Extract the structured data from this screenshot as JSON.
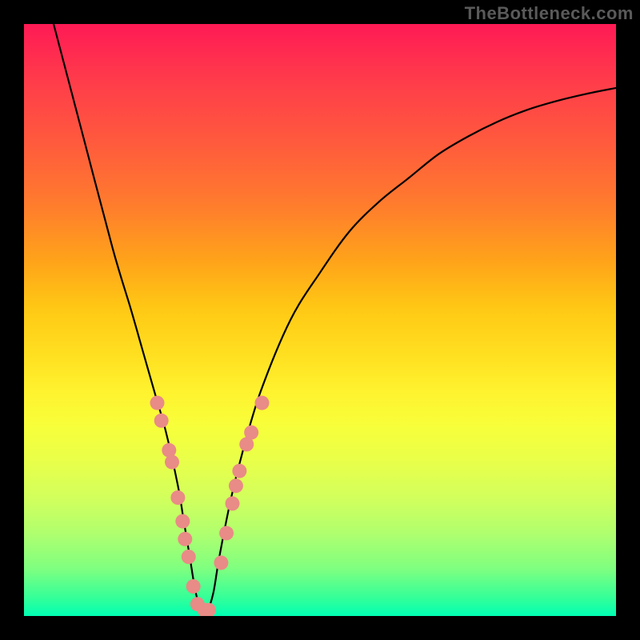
{
  "watermark": "TheBottleneck.com",
  "chart_data": {
    "type": "line",
    "title": "",
    "xlabel": "",
    "ylabel": "",
    "xlim": [
      0,
      100
    ],
    "ylim": [
      0,
      100
    ],
    "series": [
      {
        "name": "bottleneck-curve",
        "x": [
          5,
          10,
          15,
          18,
          20,
          22,
          24,
          26,
          27,
          28,
          29,
          30,
          31,
          32,
          33,
          35,
          37,
          40,
          45,
          50,
          55,
          60,
          65,
          70,
          75,
          80,
          85,
          90,
          95,
          100
        ],
        "y": [
          100,
          81,
          62,
          52,
          45,
          38,
          31,
          22,
          16,
          10,
          4,
          1,
          1,
          4,
          10,
          20,
          28,
          38,
          50,
          58,
          65,
          70,
          74,
          78,
          81,
          83.5,
          85.5,
          87,
          88.2,
          89.2
        ]
      }
    ],
    "markers": {
      "name": "highlighted-points",
      "color": "#e98b86",
      "radius_px": 9,
      "points": [
        {
          "x": 22.5,
          "y": 36
        },
        {
          "x": 23.2,
          "y": 33
        },
        {
          "x": 24.5,
          "y": 28
        },
        {
          "x": 25.0,
          "y": 26
        },
        {
          "x": 26.0,
          "y": 20
        },
        {
          "x": 26.8,
          "y": 16
        },
        {
          "x": 27.2,
          "y": 13
        },
        {
          "x": 27.8,
          "y": 10
        },
        {
          "x": 28.6,
          "y": 5
        },
        {
          "x": 29.3,
          "y": 2
        },
        {
          "x": 30.5,
          "y": 1
        },
        {
          "x": 31.2,
          "y": 1
        },
        {
          "x": 33.3,
          "y": 9
        },
        {
          "x": 34.2,
          "y": 14
        },
        {
          "x": 35.2,
          "y": 19
        },
        {
          "x": 35.8,
          "y": 22
        },
        {
          "x": 36.4,
          "y": 24.5
        },
        {
          "x": 37.6,
          "y": 29
        },
        {
          "x": 38.4,
          "y": 31
        },
        {
          "x": 40.2,
          "y": 36
        }
      ]
    }
  }
}
